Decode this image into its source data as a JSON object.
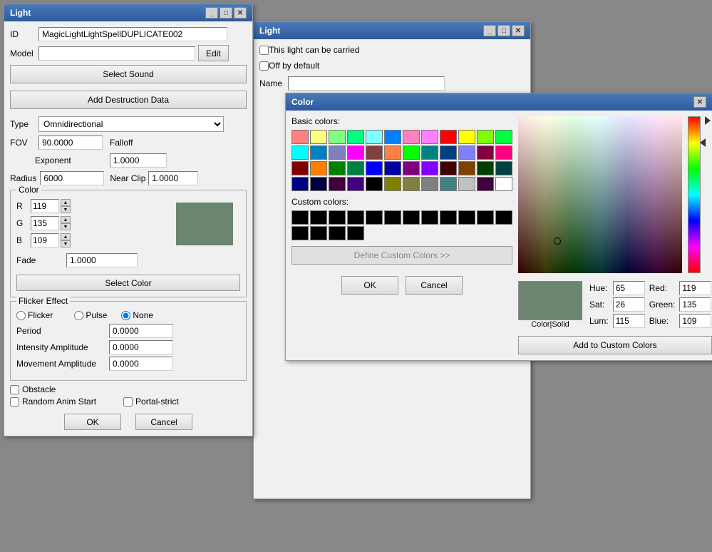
{
  "light_window": {
    "title": "Light",
    "id_label": "ID",
    "id_value": "MagicLightLightSpellDUPLICATE002",
    "model_label": "Model",
    "model_value": "",
    "edit_btn": "Edit",
    "select_sound_btn": "Select Sound",
    "add_destruction_btn": "Add Destruction Data",
    "type_label": "Type",
    "type_value": "Omnidirectional",
    "fov_label": "FOV",
    "fov_value": "90.0000",
    "falloff_label": "Falloff",
    "falloff_exponent_label": "Exponent",
    "falloff_value": "1.0000",
    "radius_label": "Radius",
    "radius_value": "6000",
    "near_clip_label": "Near Clip",
    "near_clip_value": "1.0000",
    "color_group": "Color",
    "r_label": "R",
    "r_value": "119",
    "g_label": "G",
    "g_value": "135",
    "b_label": "B",
    "b_value": "109",
    "fade_label": "Fade",
    "fade_value": "1.0000",
    "select_color_btn": "Select Color",
    "flicker_group": "Flicker Effect",
    "flicker_radio": "Flicker",
    "pulse_radio": "Pulse",
    "none_radio": "None",
    "period_label": "Period",
    "period_value": "0.0000",
    "intensity_label": "Intensity Amplitude",
    "intensity_value": "0.0000",
    "movement_label": "Movement Amplitude",
    "movement_value": "0.0000",
    "obstacle_cb": "Obstacle",
    "random_anim_cb": "Random Anim Start",
    "portal_strict_cb": "Portal-strict",
    "ok_btn": "OK",
    "cancel_btn": "Cancel"
  },
  "bg_window": {
    "title": "Light",
    "carried_label": "This light can be carried",
    "off_default_label": "Off by default",
    "name_label": "Name"
  },
  "color_dialog": {
    "title": "Color",
    "close_btn": "✕",
    "basic_colors_label": "Basic colors:",
    "custom_colors_label": "Custom colors:",
    "define_custom_btn": "Define Custom Colors >>",
    "ok_btn": "OK",
    "cancel_btn": "Cancel",
    "add_custom_btn": "Add to Custom Colors",
    "color_solid_label": "Color|Solid",
    "hue_label": "Hue:",
    "hue_value": "65",
    "sat_label": "Sat:",
    "sat_value": "26",
    "lum_label": "Lum:",
    "lum_value": "115",
    "red_label": "Red:",
    "red_value": "119",
    "green_label": "Green:",
    "green_value": "135",
    "blue_label": "Blue:",
    "blue_value": "109",
    "basic_colors": [
      "#ff8080",
      "#ffff80",
      "#80ff80",
      "#00ff80",
      "#80ffff",
      "#0080ff",
      "#ff80c0",
      "#ff80ff",
      "#ff0000",
      "#ffff00",
      "#80ff00",
      "#00ff40",
      "#00ffff",
      "#0080c0",
      "#8080c0",
      "#ff00ff",
      "#804040",
      "#ff8040",
      "#00ff00",
      "#008080",
      "#004080",
      "#8080ff",
      "#800040",
      "#ff0080",
      "#800000",
      "#ff8000",
      "#008000",
      "#008040",
      "#0000ff",
      "#0000a0",
      "#800080",
      "#8000ff",
      "#400000",
      "#804000",
      "#004000",
      "#004040",
      "#000080",
      "#000040",
      "#400040",
      "#400080",
      "#000000",
      "#808000",
      "#808040",
      "#808080",
      "#408080",
      "#c0c0c0",
      "#400040",
      "#ffffff"
    ]
  }
}
